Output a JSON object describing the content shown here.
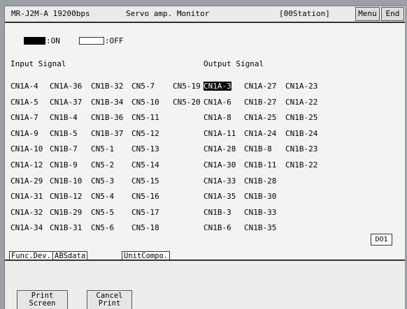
{
  "header": {
    "device": "MR-J2M-A 19200bps",
    "title": "Servo amp. Monitor",
    "station": "[00Station]",
    "menu_label": "Menu",
    "end_label": "End"
  },
  "legend": {
    "on_label": ":ON",
    "off_label": ":OFF"
  },
  "input": {
    "heading": "Input Signal",
    "columns": [
      [
        "CN1A-4",
        "CN1A-5",
        "CN1A-7",
        "CN1A-9",
        "CN1A-10",
        "CN1A-12",
        "CN1A-29",
        "CN1A-31",
        "CN1A-32",
        "CN1A-34"
      ],
      [
        "CN1A-36",
        "CN1A-37",
        "CN1B-4",
        "CN1B-5",
        "CN1B-7",
        "CN1B-9",
        "CN1B-10",
        "CN1B-12",
        "CN1B-29",
        "CN1B-31"
      ],
      [
        "CN1B-32",
        "CN1B-34",
        "CN1B-36",
        "CN1B-37",
        "CN5-1",
        "CN5-2",
        "CN5-3",
        "CN5-4",
        "CN5-5",
        "CN5-6"
      ],
      [
        "CN5-7",
        "CN5-10",
        "CN5-11",
        "CN5-12",
        "CN5-13",
        "CN5-14",
        "CN5-15",
        "CN5-16",
        "CN5-17",
        "CN5-18"
      ],
      [
        "CN5-19",
        "CN5-20"
      ]
    ]
  },
  "output": {
    "heading": "Output Signal",
    "active": "CN1A-3",
    "columns": [
      [
        "CN1A-3",
        "CN1A-6",
        "CN1A-8",
        "CN1A-11",
        "CN1A-28",
        "CN1A-30",
        "CN1A-33",
        "CN1A-35",
        "CN1B-3",
        "CN1B-6"
      ],
      [
        "CN1A-27",
        "CN1B-27",
        "CN1A-25",
        "CN1A-24",
        "CN1B-8",
        "CN1B-11",
        "CN1B-28",
        "CN1B-30",
        "CN1B-33",
        "CN1B-35"
      ],
      [
        "CN1A-23",
        "CN1A-22",
        "CN1B-25",
        "CN1B-24",
        "CN1B-23",
        "CN1B-22"
      ]
    ]
  },
  "do_button": "DO1",
  "tabs": [
    "Func.Dev.",
    "ABSdata",
    "UnitCompo."
  ],
  "buttons": {
    "print_screen": [
      "Print",
      "Screen"
    ],
    "cancel_print": [
      "Cancel",
      "Print"
    ]
  }
}
